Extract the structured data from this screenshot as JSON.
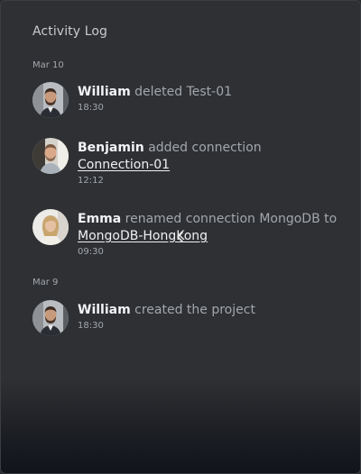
{
  "title": "Activity Log",
  "groups": [
    {
      "date": "Mar 10",
      "entries": [
        {
          "user": "William",
          "action": "deleted Test-01",
          "link": "",
          "time": "18:30"
        },
        {
          "user": "Benjamin",
          "action": "added connection",
          "link": "Connection-01",
          "time": "12:12"
        },
        {
          "user": "Emma",
          "action": "renamed connection MongoDB to",
          "link": "MongoDB-HongKong",
          "time": "09:30"
        }
      ]
    },
    {
      "date": "Mar 9",
      "entries": [
        {
          "user": "William",
          "action": "created the project",
          "link": "",
          "time": "18:30"
        }
      ]
    }
  ],
  "colors": {
    "background": "#2e3033",
    "username": "#f2f3f5",
    "action_text": "#a3a7ac",
    "meta_text": "#a4a8ad"
  }
}
